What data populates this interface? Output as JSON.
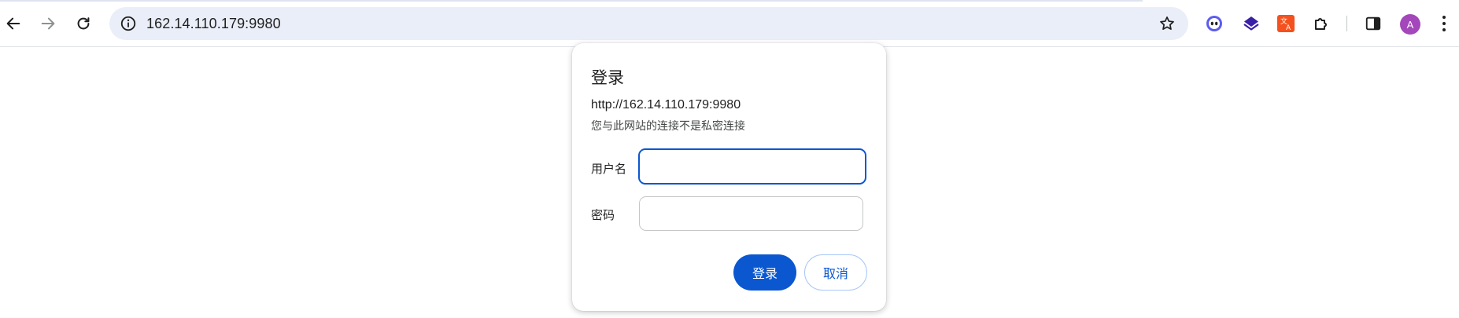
{
  "browser": {
    "address_bar": {
      "url": "162.14.110.179:9980"
    },
    "icons": {
      "back": "arrow-left-icon",
      "forward": "arrow-right-icon",
      "reload": "reload-icon",
      "site_info": "info-icon",
      "bookmark": "star-icon",
      "extensions": [
        "face-extension-icon",
        "stack-extension-icon",
        "translate-extension-icon",
        "puzzle-extensions-icon"
      ],
      "side_panel": "side-panel-icon",
      "menu": "more-vertical-icon"
    },
    "profile_initial": "A"
  },
  "auth_dialog": {
    "title": "登录",
    "origin": "http://162.14.110.179:9980",
    "warning": "您与此网站的连接不是私密连接",
    "username_label": "用户名",
    "username_value": "",
    "password_label": "密码",
    "password_value": "",
    "submit_label": "登录",
    "cancel_label": "取消"
  },
  "colors": {
    "accent": "#0b57d0",
    "omnibox_bg": "#eaeef8",
    "avatar": "#a347ba"
  }
}
